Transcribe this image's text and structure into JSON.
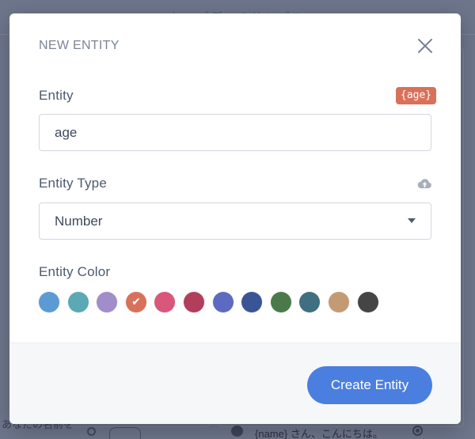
{
  "background": {
    "header_title": "ヒーブデーのサンプル",
    "left_snippet": "あなたの名前を",
    "right_snippet": "{name} さん、こんにちは。"
  },
  "modal": {
    "title": "NEW ENTITY",
    "close_icon": "close-icon",
    "entity": {
      "label": "Entity",
      "tag": "{age}",
      "value": "age"
    },
    "entity_type": {
      "label": "Entity Type",
      "upload_icon": "cloud-upload-icon",
      "selected": "Number"
    },
    "entity_color": {
      "label": "Entity Color",
      "selected_index": 3,
      "swatches": [
        "#5b9bd4",
        "#5aa9b4",
        "#a08dc9",
        "#d9705a",
        "#d9577a",
        "#b13e5b",
        "#5c6bc0",
        "#3a5595",
        "#4a7a4a",
        "#3f6f80",
        "#c49a74",
        "#454545"
      ]
    },
    "submit_label": "Create Entity"
  },
  "colors": {
    "accent": "#4a7fe0",
    "tag": "#d9705a",
    "overlay": "#6f778d"
  }
}
